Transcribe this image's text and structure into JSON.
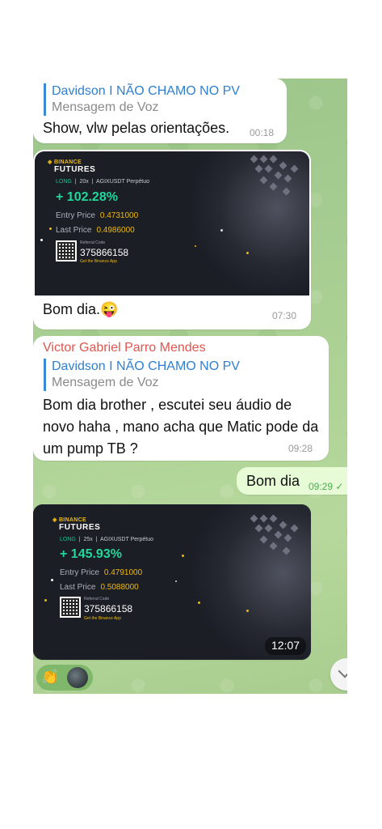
{
  "messages": {
    "m1": {
      "reply_name": "Davidson I NÃO CHAMO NO PV",
      "reply_type": "Mensagem de Voz",
      "text": "Show, vlw pelas orientações.",
      "time": "00:18"
    },
    "m2": {
      "caption": "Bom dia.😜",
      "time": "07:30",
      "card": {
        "logo": "BINANCE",
        "product": "FUTURES",
        "side": "LONG",
        "leverage": "20x",
        "pair": "AGIXUSDT Perpétuo",
        "pnl": "+ 102.28%",
        "entry_label": "Entry Price",
        "entry_value": "0.4731000",
        "last_label": "Last Price",
        "last_value": "0.4986000",
        "ref_label": "Referral Code",
        "ref_code": "375866158",
        "get_app": "Get the Binance App"
      }
    },
    "m3": {
      "sender": "Victor Gabriel Parro Mendes",
      "reply_name": "Davidson I NÃO CHAMO NO PV",
      "reply_type": "Mensagem de Voz",
      "text": "Bom dia brother , escutei seu áudio de novo haha , mano acha que Matic pode da um pump TB ?",
      "time": "09:28"
    },
    "m4": {
      "text": "Bom dia",
      "time": "09:29"
    },
    "m5": {
      "time": "12:07",
      "card": {
        "logo": "BINANCE",
        "product": "FUTURES",
        "side": "LONG",
        "leverage": "25x",
        "pair": "AGIXUSDT Perpétuo",
        "pnl": "+ 145.93%",
        "entry_label": "Entry Price",
        "entry_value": "0.4791000",
        "last_label": "Last Price",
        "last_value": "0.5088000",
        "ref_label": "Referral Code",
        "ref_code": "375866158",
        "get_app": "Get the Binance App"
      }
    },
    "reactions": {
      "emoji": "👏"
    }
  },
  "icons": {
    "read_receipt": "check-icon",
    "scroll_down": "chevron-down-icon"
  },
  "colors": {
    "accent": "#2f7fcf",
    "sender": "#e0554d",
    "outgoing": "#e7fcd6",
    "binance": "#f0b90b",
    "profit": "#1fd89a"
  }
}
